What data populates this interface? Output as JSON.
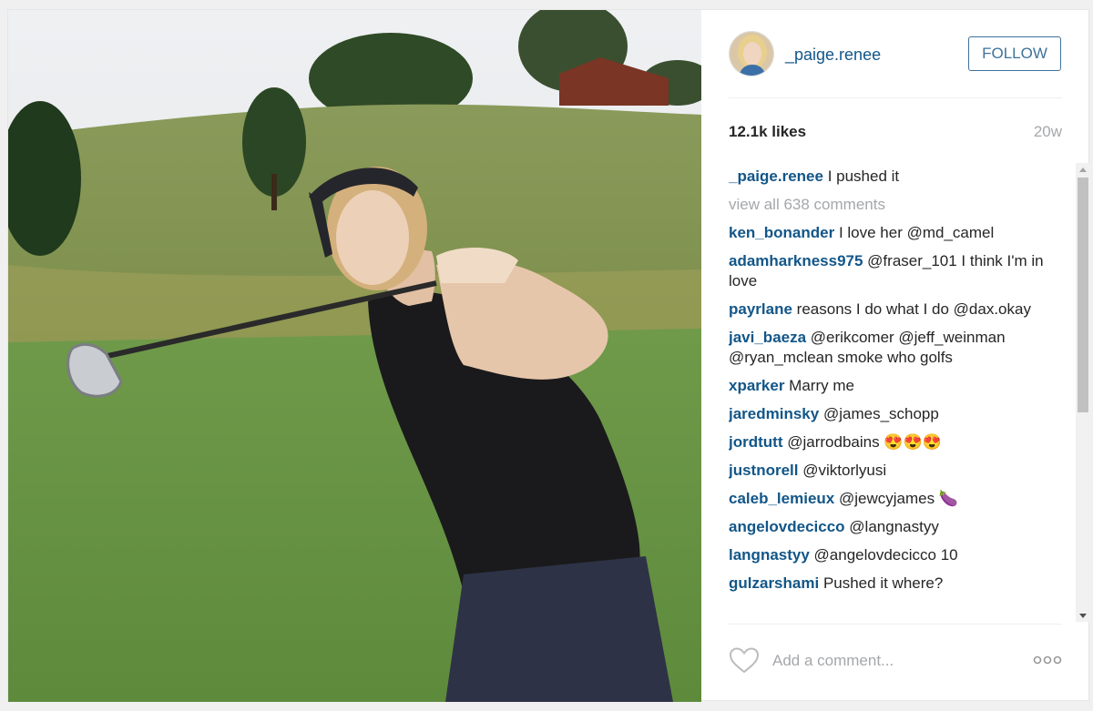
{
  "post": {
    "username": "_paige.renee",
    "follow_label": "FOLLOW",
    "likes": "12.1k likes",
    "age": "20w",
    "caption": {
      "user": "_paige.renee",
      "text": "I pushed it"
    },
    "view_all": "view all 638 comments",
    "comments": [
      {
        "user": "ken_bonander",
        "text": "I love her @md_camel"
      },
      {
        "user": "adamharkness975",
        "text": "@fraser_101 I think I'm in love"
      },
      {
        "user": "payrlane",
        "text": "reasons I do what I do @dax.okay"
      },
      {
        "user": "javi_baeza",
        "text": "@erikcomer @jeff_weinman @ryan_mclean smoke who golfs"
      },
      {
        "user": "xparker",
        "text": "Marry me"
      },
      {
        "user": "jaredminsky",
        "text": "@james_schopp"
      },
      {
        "user": "jordtutt",
        "text": "@jarrodbains 😍😍😍"
      },
      {
        "user": "justnorell",
        "text": "@viktorlyusi"
      },
      {
        "user": "caleb_lemieux",
        "text": "@jewcyjames 🍆"
      },
      {
        "user": "angelovdecicco",
        "text": "@langnastyy"
      },
      {
        "user": "langnastyy",
        "text": "@angelovdecicco 10"
      },
      {
        "user": "gulzarshami",
        "text": "Pushed it where?"
      }
    ],
    "comment_placeholder": "Add a comment...",
    "icons": {
      "like": "heart-icon",
      "more": "more-options-icon"
    }
  },
  "colors": {
    "username_blue": "#125688",
    "follow_blue": "#3f729b",
    "muted_gray": "#a5a7aa"
  }
}
